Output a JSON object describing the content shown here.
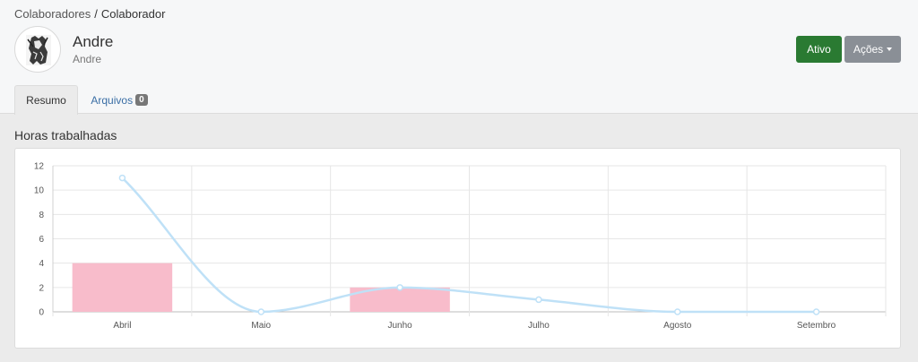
{
  "breadcrumb": {
    "parent": "Colaboradores",
    "separator": "/",
    "current": "Colaborador"
  },
  "profile": {
    "name": "Andre",
    "subtitle": "Andre",
    "avatar_icon": "avatar-engraving-icon"
  },
  "actions": {
    "ativo_label": "Ativo",
    "acoes_label": "Ações",
    "ativo_color": "#2a7a32",
    "acoes_color": "#8a8f96"
  },
  "tabs": [
    {
      "label": "Resumo",
      "active": true
    },
    {
      "label": "Arquivos",
      "badge": "0",
      "active": false
    }
  ],
  "section": {
    "title": "Horas trabalhadas"
  },
  "chart_data": {
    "type": "bar",
    "categories": [
      "Abril",
      "Maio",
      "Junho",
      "Julho",
      "Agosto",
      "Setembro"
    ],
    "series": [
      {
        "type": "bar",
        "values": [
          4,
          0,
          2,
          0,
          0,
          0
        ],
        "color": "#f8bccb"
      },
      {
        "type": "line",
        "smooth": true,
        "values": [
          11,
          0,
          2,
          1,
          0,
          0
        ],
        "color": "#bfe1f7"
      }
    ],
    "ylim": [
      0,
      12
    ],
    "yticks": [
      0,
      2,
      4,
      6,
      8,
      10,
      12
    ],
    "grid": true,
    "legend": "none"
  }
}
